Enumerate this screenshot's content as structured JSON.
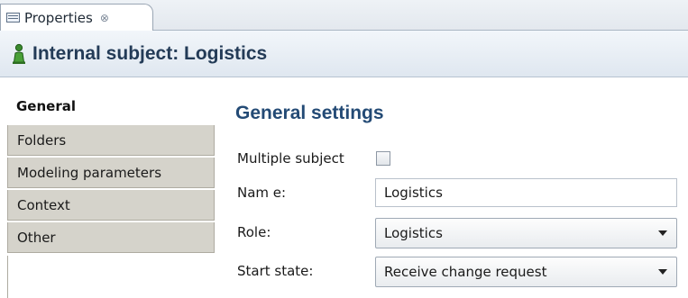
{
  "tab": {
    "label": "Properties",
    "close_glyph": "⊗"
  },
  "header": {
    "title": "Internal subject: Logistics",
    "icon": "person-icon"
  },
  "sidebar": {
    "items": [
      {
        "label": "General",
        "active": true
      },
      {
        "label": "Folders",
        "active": false
      },
      {
        "label": "Modeling parameters",
        "active": false
      },
      {
        "label": "Context",
        "active": false
      },
      {
        "label": "Other",
        "active": false
      }
    ]
  },
  "general": {
    "section_title": "General settings",
    "multiple_subject": {
      "label": "Multiple subject",
      "checked": false
    },
    "name": {
      "label": "Nam e:",
      "value": "Logistics"
    },
    "role": {
      "label": "Role:",
      "value": "Logistics"
    },
    "start_state": {
      "label": "Start state:",
      "value": "Receive change request"
    }
  },
  "colors": {
    "title": "#233b57",
    "section_title": "#234a75",
    "sidebar_tab": "#d5d3cb"
  }
}
